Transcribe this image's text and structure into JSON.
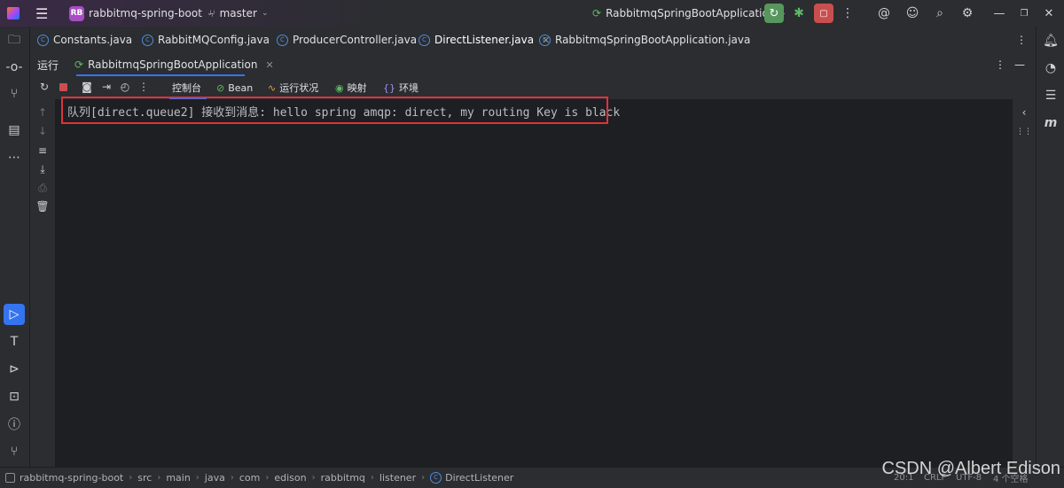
{
  "titlebar": {
    "project_badge": "RB",
    "project_name": "rabbitmq-spring-boot",
    "branch": "master",
    "run_config": "RabbitmqSpringBootApplication"
  },
  "editor_tabs": [
    {
      "label": "Constants.java"
    },
    {
      "label": "RabbitMQConfig.java"
    },
    {
      "label": "ProducerController.java"
    },
    {
      "label": "DirectListener.java",
      "active": true
    },
    {
      "label": "RabbitmqSpringBootApplication.java"
    }
  ],
  "run_window": {
    "title": "运行",
    "tab_label": "RabbitmqSpringBootApplication",
    "toolbar_tabs": {
      "console": "控制台",
      "bean": "Bean",
      "health": "运行状况",
      "mappings": "映射",
      "env": "环境"
    }
  },
  "console": {
    "line": "队列[direct.queue2] 接收到消息: hello spring amqp: direct, my routing Key is black"
  },
  "breadcrumb": [
    "rabbitmq-spring-boot",
    "src",
    "main",
    "java",
    "com",
    "edison",
    "rabbitmq",
    "listener",
    "DirectListener"
  ],
  "status": {
    "position": "20:1",
    "line_sep": "CRLF",
    "encoding": "UTF-8",
    "indent": "4 个空格"
  },
  "watermark": "CSDN @Albert Edison",
  "colors": {
    "accent": "#3574f0",
    "highlight": "#e0323c",
    "run_green": "#57965c",
    "stop_red": "#c94f4f"
  }
}
